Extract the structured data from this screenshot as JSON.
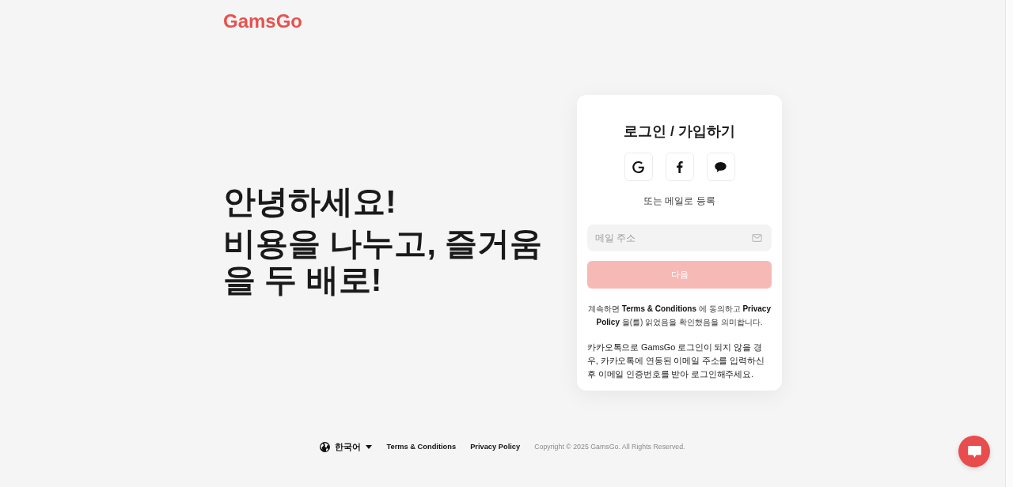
{
  "header": {
    "logo": "GamsGo"
  },
  "hero": {
    "greeting": "안녕하세요!",
    "tagline": "비용을 나누고, 즐거움을 두 배로!"
  },
  "login_card": {
    "title": "로그인 / 가입하기",
    "social_buttons": [
      {
        "kind": "google"
      },
      {
        "kind": "facebook"
      },
      {
        "kind": "kakaotalk"
      }
    ],
    "divider_text": "또는 메일로 등록",
    "email_field": {
      "placeholder": "메일 주소"
    },
    "next_button": {
      "label": "다음",
      "disabled": true
    },
    "terms_text": "계속하면 **Terms & Conditions** 에 동의하고 **Privacy Policy** 을(를) 읽었음을 확인했음을 의미합니다.",
    "notice": "카카오톡으로 GamsGo 로그인이 되지 않을 경우, 카카오톡에 연동된 이메일 주소를 입력하신 후 이메일 인증번호를 받아 로그인해주세요."
  },
  "footer": {
    "language": "한국어",
    "links": [
      "Terms & Conditions",
      "Privacy Policy"
    ],
    "copyright": "Copyright © 2025 GamsGo. All Rights Reserved."
  }
}
